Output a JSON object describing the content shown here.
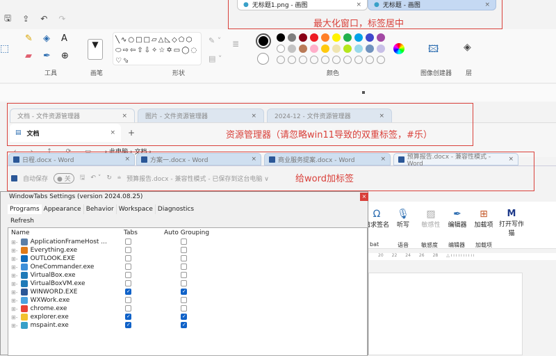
{
  "paint": {
    "tabs": [
      {
        "label": "无标题1.png - 画图",
        "active": true
      },
      {
        "label": "无标题 - 画图",
        "active": false
      }
    ],
    "annotation": "最大化窗口，标签居中",
    "groups": {
      "tools": "工具",
      "brushes": "画笔",
      "shapes": "形状",
      "colors": "颜色",
      "image_creator": "图像创建器",
      "layers": "层"
    },
    "shapes_glyphs": "╲∿○□□▱△◺◇⬠⬡⬭⇨⇦⇧⇩✧☆✡▭◯◌♡⬂",
    "colors_row1": [
      "#000000",
      "#7f7f7f",
      "#880015",
      "#ed1c24",
      "#ff7f27",
      "#fff200",
      "#22b14c",
      "#00a2e8",
      "#3f48cc",
      "#a349a4"
    ],
    "colors_row2": [
      "#ffffff",
      "#c3c3c3",
      "#b97a57",
      "#ffaec9",
      "#ffc90e",
      "#efe4b0",
      "#b5e61d",
      "#99d9ea",
      "#7092be",
      "#c8bfe7"
    ],
    "primary_color": "#000000",
    "secondary_color": "#ffffff"
  },
  "explorer": {
    "outer_tabs": [
      "文档 - 文件资源管理器",
      "图片 - 文件资源管理器",
      "2024-12 - 文件资源管理器"
    ],
    "inner_tab": "文档",
    "annotation": "资源管理器（请忽略win11导致的双重标签，#乐）",
    "breadcrumb": [
      "此电脑",
      "文档"
    ]
  },
  "word": {
    "tabs": [
      "日程.docx - Word",
      "方案一.docx - Word",
      "商业服务提案.docx - Word",
      "预算报告.docx - 兼容性模式 - Word"
    ],
    "autosave": "自动保存",
    "autosave_state": "关",
    "doc_title": "预算报告.docx - 兼容性模式 - 已保存到这台电脑 ∨",
    "annotation": "给word加标签",
    "ribbon": [
      {
        "label": "请求签名"
      },
      {
        "label": "听写"
      },
      {
        "label": "敏感性"
      },
      {
        "label": "编辑器"
      },
      {
        "label": "加载项"
      },
      {
        "label": "打开写作猫"
      }
    ],
    "groups": [
      "bat",
      "语音",
      "敏感度",
      "编辑器",
      "加载项"
    ],
    "ruler": [
      "20",
      "22",
      "24",
      "26",
      "28"
    ]
  },
  "settings": {
    "title": "WindowTabs Settings (version 2024.08.25)",
    "tabs": [
      "Programs",
      "Appearance",
      "Behavior",
      "Workspace",
      "Diagnostics"
    ],
    "refresh": "Refresh",
    "columns": [
      "Name",
      "Tabs",
      "Auto Grouping"
    ],
    "programs": [
      {
        "name": "ApplicationFrameHost ...",
        "tabs": false,
        "auto": false,
        "color": "#5b7fa8"
      },
      {
        "name": "Everything.exe",
        "tabs": false,
        "auto": false,
        "color": "#e07b1a"
      },
      {
        "name": "OUTLOOK.EXE",
        "tabs": false,
        "auto": false,
        "color": "#0f6cbd"
      },
      {
        "name": "OneCommander.exe",
        "tabs": false,
        "auto": false,
        "color": "#3d8fd9"
      },
      {
        "name": "VirtualBox.exe",
        "tabs": false,
        "auto": false,
        "color": "#1f7ab8"
      },
      {
        "name": "VirtualBoxVM.exe",
        "tabs": false,
        "auto": false,
        "color": "#1f7ab8"
      },
      {
        "name": "WINWORD.EXE",
        "tabs": true,
        "auto": true,
        "color": "#2b5797"
      },
      {
        "name": "WXWork.exe",
        "tabs": false,
        "auto": false,
        "color": "#4aa3e0"
      },
      {
        "name": "chrome.exe",
        "tabs": false,
        "auto": false,
        "color": "#e94235"
      },
      {
        "name": "explorer.exe",
        "tabs": true,
        "auto": true,
        "color": "#f2c12e"
      },
      {
        "name": "mspaint.exe",
        "tabs": true,
        "auto": true,
        "color": "#38a0c8"
      }
    ]
  }
}
